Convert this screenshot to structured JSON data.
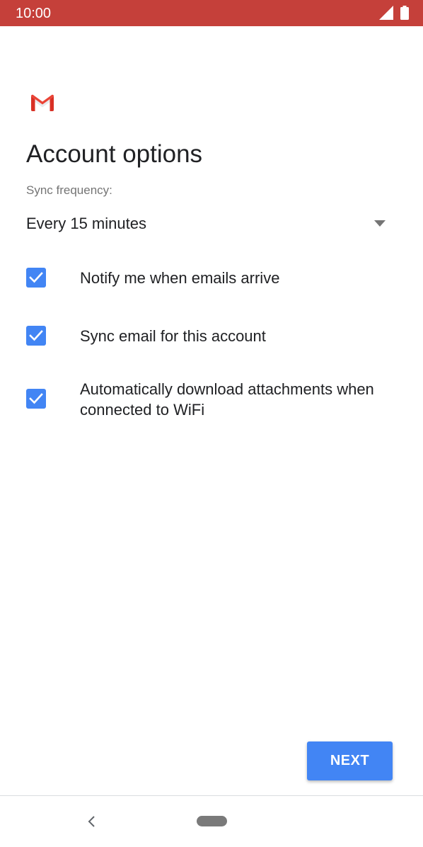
{
  "status_bar": {
    "time": "10:00",
    "icons": [
      "signal-icon",
      "battery-icon"
    ],
    "background": "#c5403a"
  },
  "app": {
    "logo": "gmail-logo"
  },
  "page": {
    "title": "Account options"
  },
  "sync": {
    "label": "Sync frequency:",
    "value": "Every 15 minutes"
  },
  "options": [
    {
      "label": "Notify me when emails arrive",
      "checked": true
    },
    {
      "label": "Sync email for this account",
      "checked": true
    },
    {
      "label": "Automatically download attachments when connected to WiFi",
      "checked": true
    }
  ],
  "actions": {
    "next_label": "NEXT"
  },
  "colors": {
    "accent": "#4285f4",
    "status_bar": "#c5403a"
  },
  "nav_bar": {
    "icons": [
      "back-icon",
      "home-pill"
    ]
  }
}
